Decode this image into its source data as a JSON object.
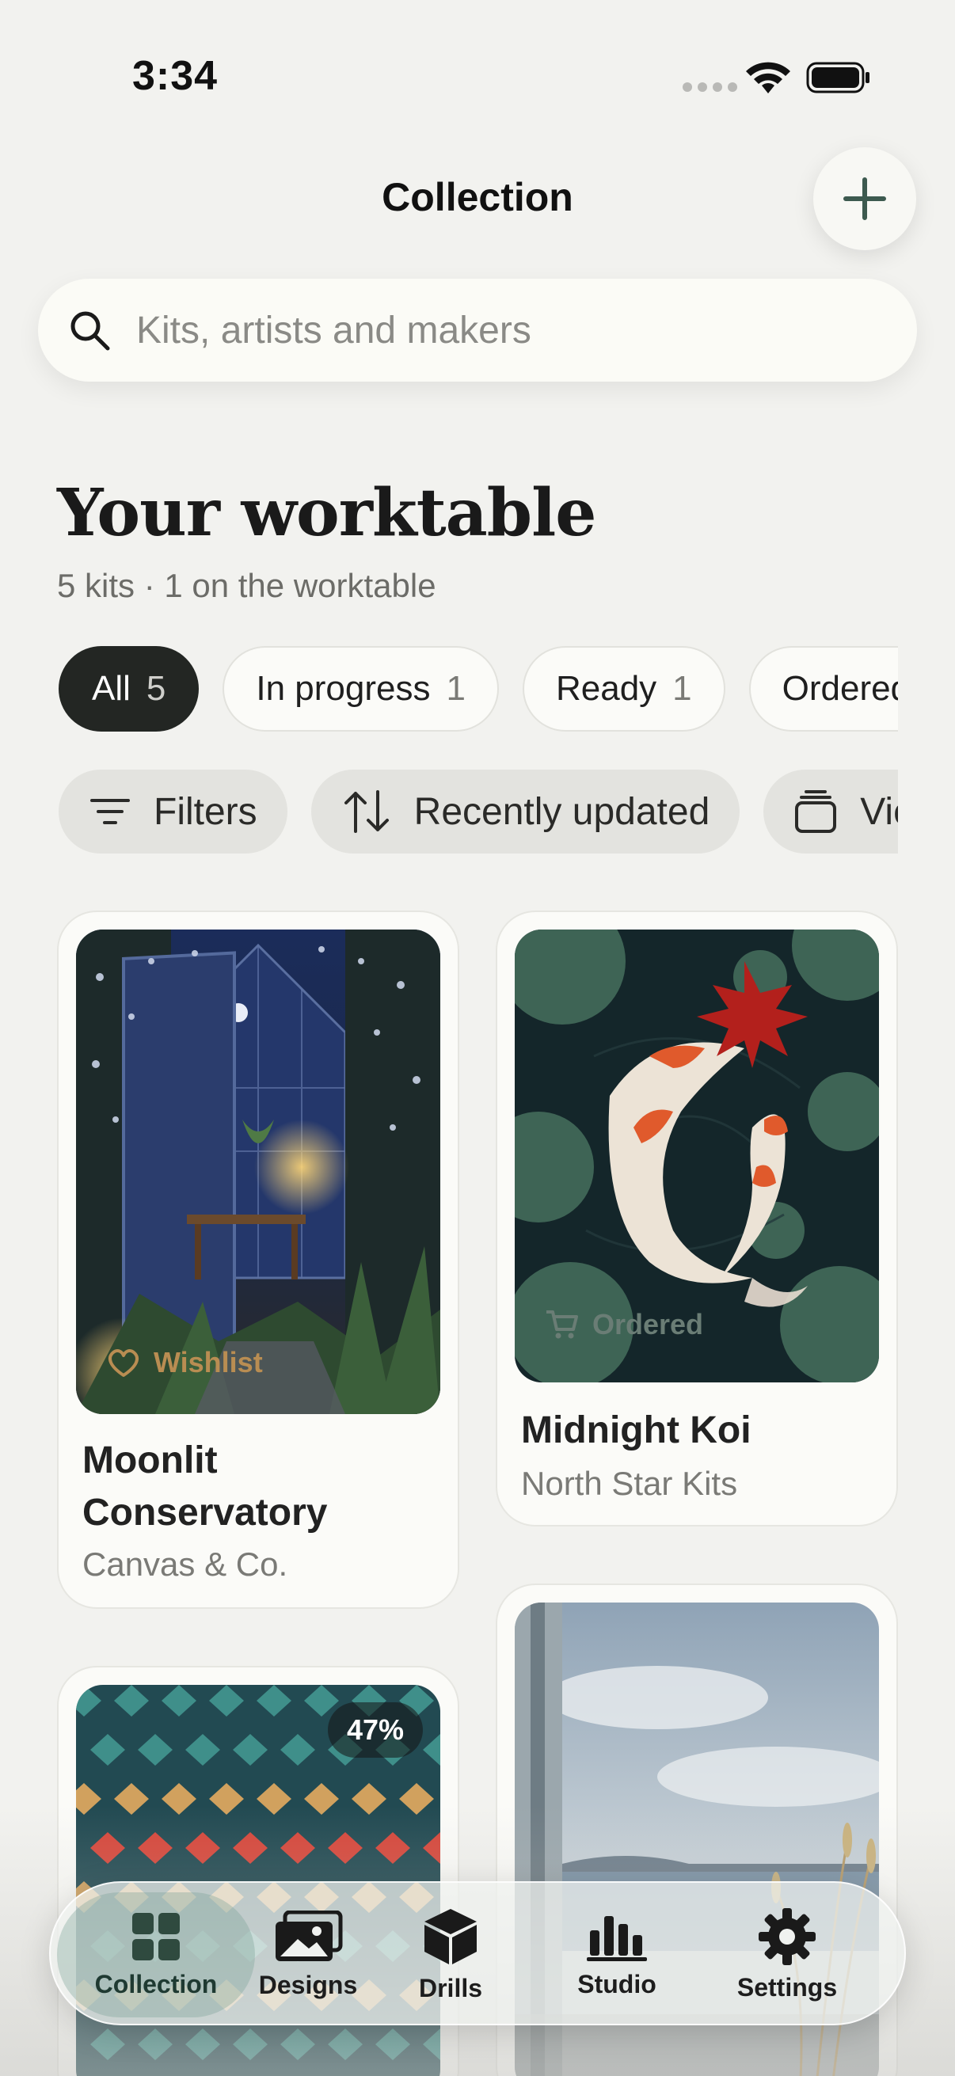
{
  "status_bar": {
    "time": "3:34"
  },
  "header": {
    "title": "Collection",
    "add_icon": "plus-icon"
  },
  "search": {
    "placeholder": "Kits, artists and makers",
    "value": ""
  },
  "worktable": {
    "title": "Your worktable",
    "subtitle": "5 kits · 1 on the worktable"
  },
  "filters": {
    "chips": [
      {
        "label": "All",
        "count": "5",
        "active": true
      },
      {
        "label": "In progress",
        "count": "1",
        "active": false
      },
      {
        "label": "Ready",
        "count": "1",
        "active": false
      },
      {
        "label": "Ordered",
        "count": "",
        "active": false
      }
    ],
    "filter_label": "Filters",
    "sort_label": "Recently updated",
    "view_label": "View"
  },
  "kits": [
    {
      "title_line1": "Moonlit",
      "title_line2": "Conservatory",
      "maker": "Canvas & Co.",
      "tag": "Wishlist",
      "tag_icon": "heart-icon"
    },
    {
      "title": "Midnight Koi",
      "maker": "North Star Kits",
      "tag": "Ordered",
      "tag_icon": "cart-icon"
    },
    {
      "progress": "47%"
    },
    {}
  ],
  "tabs": [
    {
      "label": "Collection",
      "icon": "grid-icon",
      "active": true
    },
    {
      "label": "Designs",
      "icon": "photos-icon",
      "active": false
    },
    {
      "label": "Drills",
      "icon": "box-icon",
      "active": false
    },
    {
      "label": "Studio",
      "icon": "chart-icon",
      "active": false
    },
    {
      "label": "Settings",
      "icon": "gear-icon",
      "active": false
    }
  ],
  "colors": {
    "accent": "#232623",
    "background": "#f2f2ef",
    "brand_green": "#3d5a4f"
  }
}
